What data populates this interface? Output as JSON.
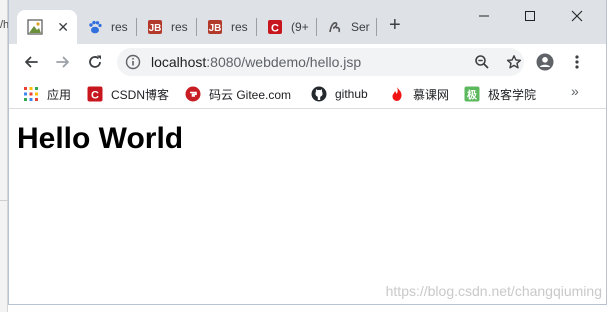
{
  "backdrop_text": "/h",
  "tabs": [
    {
      "label": "",
      "active": true
    },
    {
      "label": "res"
    },
    {
      "label": "res"
    },
    {
      "label": "res"
    },
    {
      "label": "(9+"
    },
    {
      "label": "Ser"
    }
  ],
  "new_tab_symbol": "+",
  "window_controls": {
    "minimize": "—",
    "maximize": "☐",
    "close": "✕"
  },
  "url": {
    "host": "localhost",
    "rest": ":8080/webdemo/hello.jsp"
  },
  "bookmarks": [
    {
      "label": "应用",
      "icon": "apps-grid-icon",
      "color": "#4285f4"
    },
    {
      "label": "CSDN博客",
      "icon": "csdn-icon",
      "color": "#c8161e"
    },
    {
      "label": "码云 Gitee.com",
      "icon": "gitee-icon",
      "color": "#c71d23"
    },
    {
      "label": "github",
      "icon": "github-icon",
      "color": "#24292e"
    },
    {
      "label": "慕课网",
      "icon": "fire-icon",
      "color": "#f01414"
    },
    {
      "label": "极客学院",
      "icon": "jike-icon",
      "color": "#5cb85c"
    }
  ],
  "more_symbol": "»",
  "page": {
    "heading": "Hello World"
  },
  "watermark": "https://blog.csdn.net/changqiuming"
}
